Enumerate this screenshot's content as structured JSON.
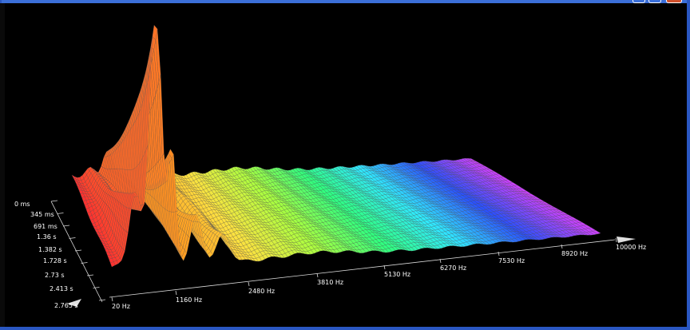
{
  "window": {
    "frame_color": "#2a57c2",
    "buttons": [
      "minimize",
      "maximize",
      "close"
    ]
  },
  "chart_data": {
    "type": "waterfall-3d",
    "title": "",
    "frequency_axis": {
      "ticks": [
        "20 Hz",
        "1160 Hz",
        "2480 Hz",
        "3810 Hz",
        "5130 Hz",
        "6270 Hz",
        "7530 Hz",
        "8920 Hz",
        "10000 Hz"
      ],
      "range": [
        20,
        10000
      ]
    },
    "time_axis": {
      "ticks": [
        "0 ms",
        "345 ms",
        "691 ms",
        "1.36 s",
        "1.382 s",
        "1.728 s",
        "2.73 s",
        "2.413 s",
        "2.765 s"
      ],
      "range": [
        0,
        2.765
      ]
    },
    "peaks_hz": [
      500,
      850,
      1000,
      1250,
      1750,
      2300
    ],
    "color_scale": [
      "#ff3030",
      "#ff9a20",
      "#ffe040",
      "#a8ff40",
      "#30ff80",
      "#30e8ff",
      "#2a50ff",
      "#d040ff"
    ],
    "grid": true
  }
}
